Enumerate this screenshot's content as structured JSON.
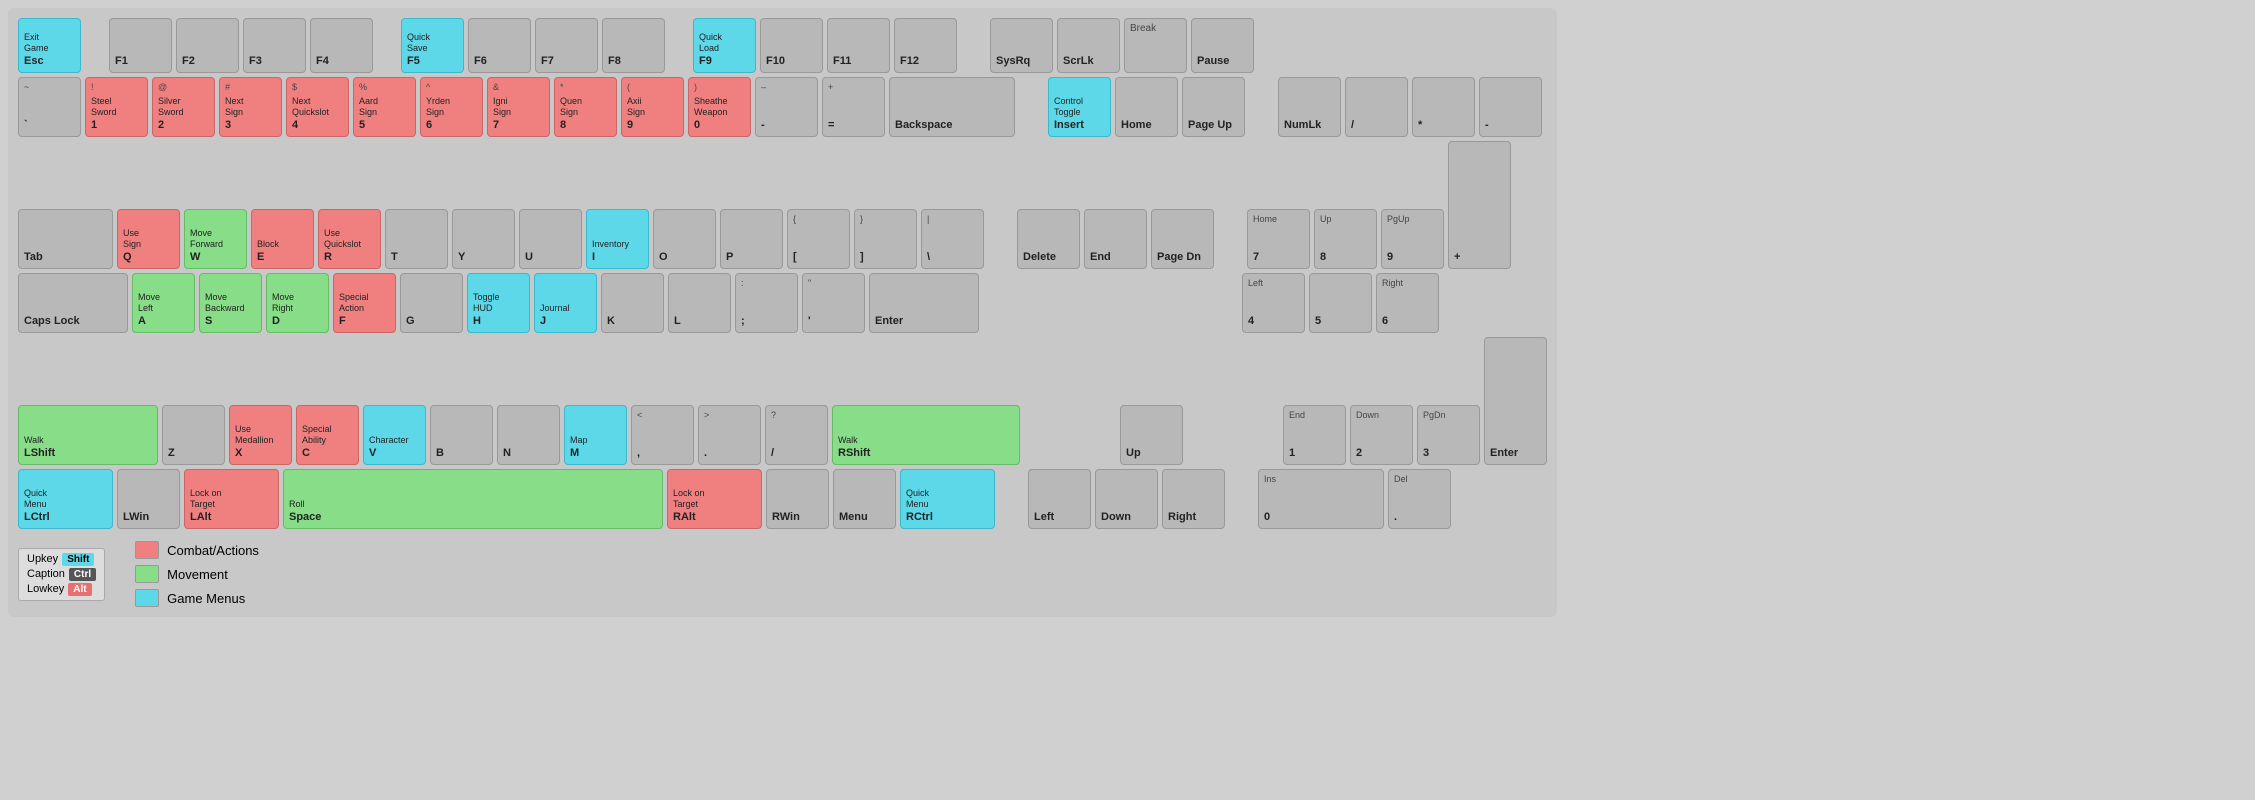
{
  "keyboard": {
    "rows": [
      {
        "id": "row-fn",
        "keys": [
          {
            "id": "esc",
            "label": "Esc",
            "top": "Exit\nGame",
            "color": "cyan",
            "width": "normal"
          },
          {
            "id": "gap1",
            "spacer": true,
            "width": "small"
          },
          {
            "id": "f1",
            "label": "F1",
            "top": "",
            "color": "normal",
            "width": "normal"
          },
          {
            "id": "f2",
            "label": "F2",
            "top": "",
            "color": "normal",
            "width": "normal"
          },
          {
            "id": "f3",
            "label": "F3",
            "top": "",
            "color": "normal",
            "width": "normal"
          },
          {
            "id": "f4",
            "label": "F4",
            "top": "",
            "color": "normal",
            "width": "normal"
          },
          {
            "id": "gap2",
            "spacer": true,
            "width": "small"
          },
          {
            "id": "f5",
            "label": "F5",
            "top": "Quick\nSave",
            "color": "cyan",
            "width": "normal"
          },
          {
            "id": "f6",
            "label": "F6",
            "top": "",
            "color": "normal",
            "width": "normal"
          },
          {
            "id": "f7",
            "label": "F7",
            "top": "",
            "color": "normal",
            "width": "normal"
          },
          {
            "id": "f8",
            "label": "F8",
            "top": "",
            "color": "normal",
            "width": "normal"
          },
          {
            "id": "gap3",
            "spacer": true,
            "width": "small"
          },
          {
            "id": "f9",
            "label": "F9",
            "top": "Quick\nLoad",
            "color": "cyan",
            "width": "normal"
          },
          {
            "id": "f10",
            "label": "F10",
            "top": "",
            "color": "normal",
            "width": "normal"
          },
          {
            "id": "f11",
            "label": "F11",
            "top": "",
            "color": "normal",
            "width": "normal"
          },
          {
            "id": "f12",
            "label": "F12",
            "top": "",
            "color": "normal",
            "width": "normal"
          },
          {
            "id": "gap4",
            "spacer": true,
            "width": "medium"
          },
          {
            "id": "sysrq",
            "label": "SysRq",
            "top": "",
            "color": "normal",
            "width": "normal"
          },
          {
            "id": "scrlk",
            "label": "ScrLk",
            "top": "",
            "color": "normal",
            "width": "normal"
          },
          {
            "id": "break",
            "label": "",
            "top": "Break",
            "color": "normal",
            "width": "normal"
          },
          {
            "id": "pause",
            "label": "Pause",
            "top": "",
            "color": "normal",
            "width": "normal"
          }
        ]
      }
    ],
    "legend": {
      "upkey_label": "Upkey",
      "caption_label": "Caption",
      "lowkey_label": "Lowkey",
      "shift_badge": "Shift",
      "ctrl_badge": "Ctrl",
      "alt_badge": "Alt",
      "items": [
        {
          "color": "pink",
          "label": "Combat/Actions"
        },
        {
          "color": "green",
          "label": "Movement"
        },
        {
          "color": "cyan",
          "label": "Game Menus"
        }
      ]
    }
  }
}
